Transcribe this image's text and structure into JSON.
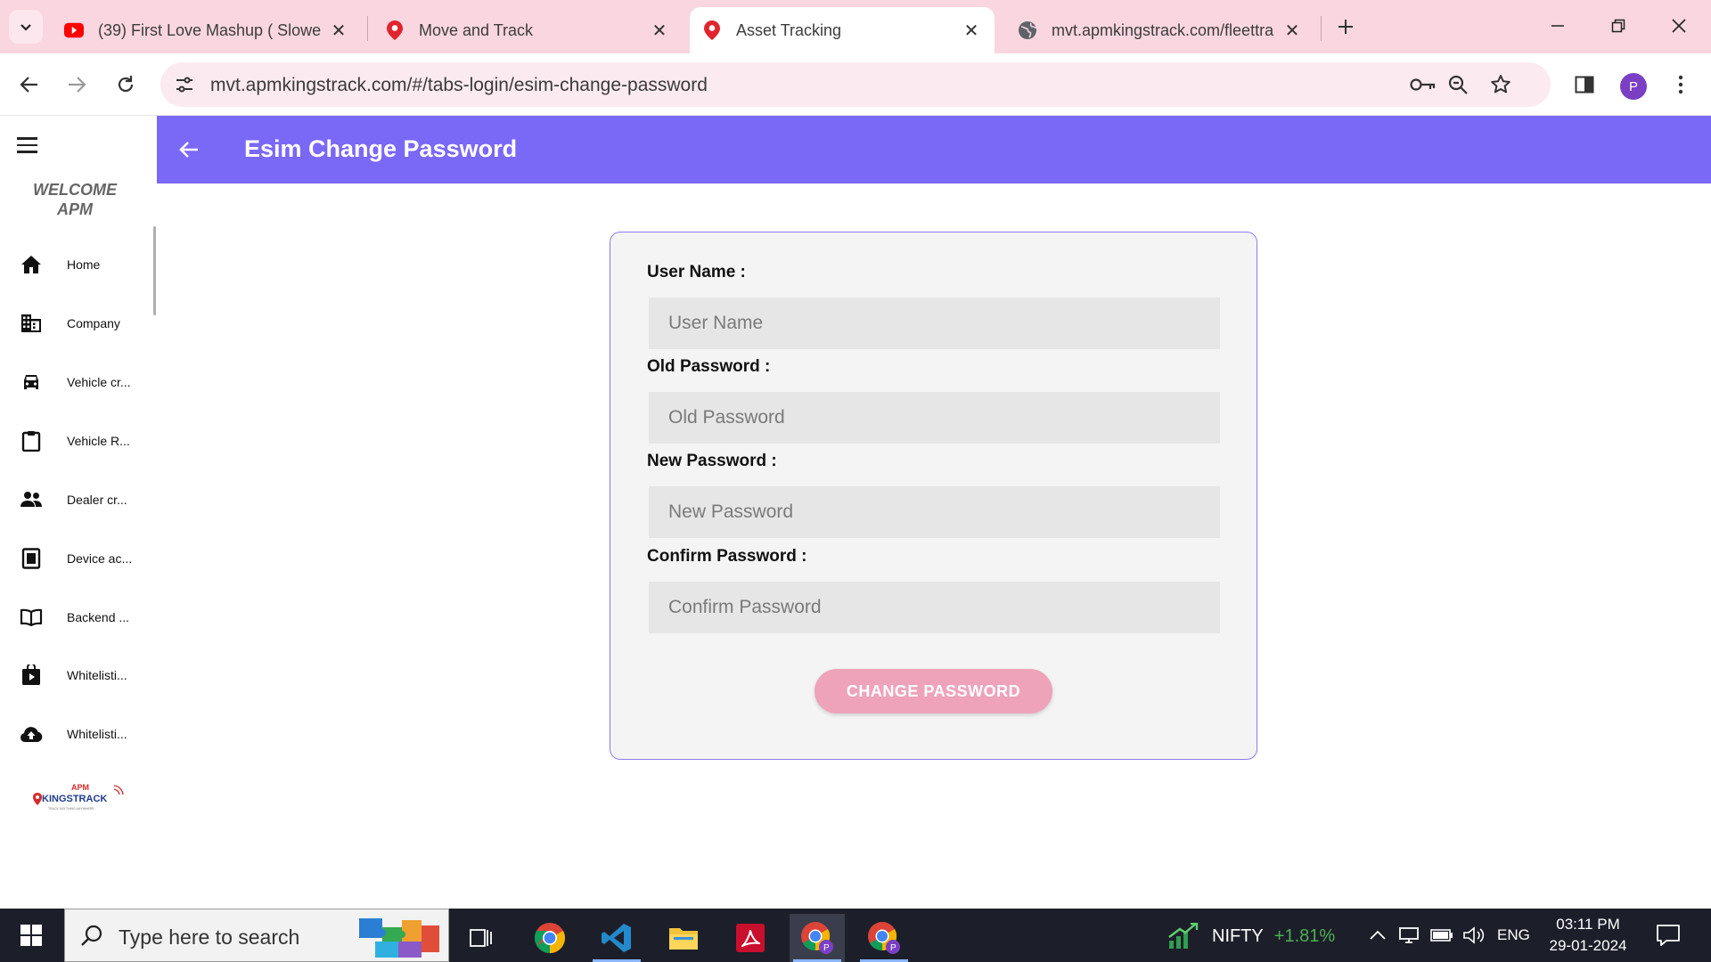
{
  "browser": {
    "tabs": [
      {
        "title": "(39) First Love Mashup ( Slowed",
        "favicon": "youtube-icon"
      },
      {
        "title": "Move and Track",
        "favicon": "map-pin-icon"
      },
      {
        "title": "Asset Tracking",
        "favicon": "map-pin-icon",
        "active": true
      },
      {
        "title": "mvt.apmkingstrack.com/fleettra",
        "favicon": "globe-icon"
      }
    ],
    "url": "mvt.apmkingstrack.com/#/tabs-login/esim-change-password",
    "profile_initial": "P"
  },
  "sidebar": {
    "welcome_line1": "WELCOME",
    "welcome_line2": "APM",
    "items": [
      {
        "label": "Home",
        "icon": "home-icon"
      },
      {
        "label": "Company",
        "icon": "building-icon"
      },
      {
        "label": "Vehicle cr...",
        "icon": "car-icon"
      },
      {
        "label": "Vehicle R...",
        "icon": "clipboard-icon"
      },
      {
        "label": "Dealer cr...",
        "icon": "people-icon"
      },
      {
        "label": "Device ac...",
        "icon": "document-icon"
      },
      {
        "label": "Backend ...",
        "icon": "book-icon"
      },
      {
        "label": "Whitelisti...",
        "icon": "video-bag-icon"
      },
      {
        "label": "Whitelisti...",
        "icon": "cloud-upload-icon"
      }
    ],
    "logo_top": "APM",
    "logo_main": "KINGSTRACK"
  },
  "header": {
    "title": "Esim Change Password"
  },
  "form": {
    "username_label": "User Name :",
    "username_placeholder": "User Name",
    "old_password_label": "Old Password :",
    "old_password_placeholder": "Old Password",
    "new_password_label": "New Password :",
    "new_password_placeholder": "New Password",
    "confirm_password_label": "Confirm Password :",
    "confirm_password_placeholder": "Confirm Password",
    "submit_label": "CHANGE PASSWORD"
  },
  "taskbar": {
    "search_placeholder": "Type here to search",
    "nifty_name": "NIFTY",
    "nifty_change": "+1.81%",
    "language": "ENG",
    "time": "03:11 PM",
    "date": "29-01-2024"
  },
  "colors": {
    "accent": "#7a68f7",
    "button": "#eea3bb",
    "tabstrip": "#f9d6e0"
  }
}
